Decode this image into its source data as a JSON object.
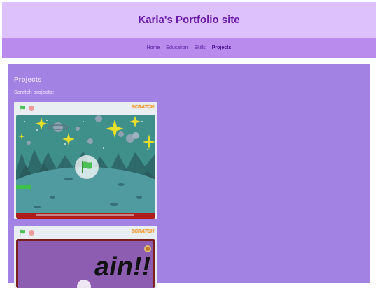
{
  "site": {
    "title": "Karla's Portfolio site"
  },
  "nav": {
    "items": [
      "Home",
      "Education",
      "Skills",
      "Projects"
    ],
    "active": "Projects"
  },
  "main": {
    "section_title": "Projects",
    "subtitle": "Scratch projects:",
    "players": [
      {
        "logo": "SCRATCH"
      },
      {
        "logo": "SCRATCH",
        "stage_text": "ain!!"
      }
    ]
  }
}
